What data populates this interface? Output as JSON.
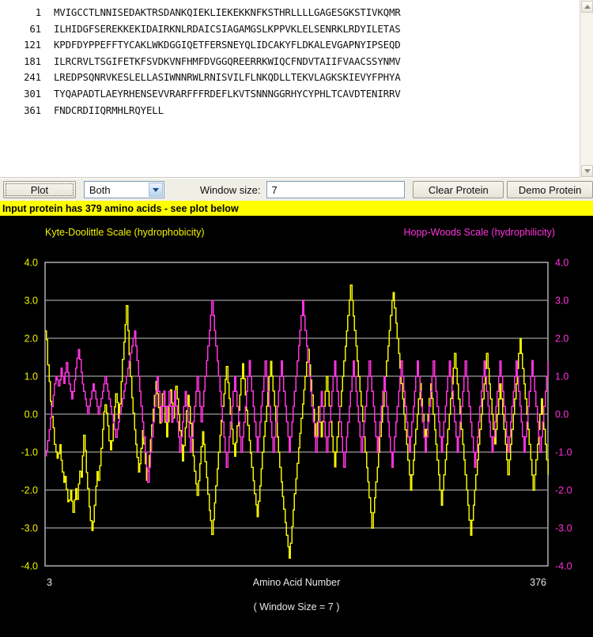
{
  "sequence": {
    "lines": [
      {
        "num": "1",
        "residues": "MVIGCCTLNNISEDAKTRSDANKQIEKLIEKEKKNFKSTHRLLLLGAGESGKSTIVKQMR"
      },
      {
        "num": "61",
        "residues": "ILHIDGFSEREKKEKIDAIRKNLRDAICSIAGAMGSLKPPVKLELSENRKLRDYILETAS"
      },
      {
        "num": "121",
        "residues": "KPDFDYPPEFFTYCAKLWKDGGIQETFERSNEYQLIDCAKYFLDKALEVGAPNYIPSEQD"
      },
      {
        "num": "181",
        "residues": "ILRCRVLTSGIFETKFSVDKVNFHMFDVGGQREERRKWIQCFNDVTAIIFVAACSSYNMV"
      },
      {
        "num": "241",
        "residues": "LREDPSQNRVKESLELLASIWNNRWLRNISVILFLNKQDLLTEKVLAGKSKIEVYFPHYA"
      },
      {
        "num": "301",
        "residues": "TYQAPADTLAEYRHENSEVVRARFFFRDEFLKVTSNNNGGRHYCYPHLTCAVDTENIRRV"
      },
      {
        "num": "361",
        "residues": "FNDCRDIIQRMHLRQYELL"
      }
    ]
  },
  "toolbar": {
    "plot_label": "Plot",
    "scale_selected": "Both",
    "scale_options": [
      "Both",
      "Kyte-Doolittle",
      "Hopp-Woods"
    ],
    "window_size_label": "Window size:",
    "window_size_value": "7",
    "clear_label": "Clear Protein",
    "demo_label": "Demo Protein"
  },
  "status": {
    "message": "Input protein has 379 amino acids - see plot below"
  },
  "chart_data": {
    "type": "line",
    "title_left": "Kyte-Doolittle Scale (hydrophobicity)",
    "title_right": "Hopp-Woods Scale (hydrophilicity)",
    "xlabel": "Amino Acid Number",
    "sublabel": "( Window Size = 7 )",
    "x_min_label": "3",
    "x_max_label": "376",
    "xlim": [
      3,
      376
    ],
    "ylim": [
      -4.0,
      4.0
    ],
    "grid": true,
    "legend_position": "top",
    "y_ticks": [
      "4.0",
      "3.0",
      "2.0",
      "1.0",
      "0.0",
      "-1.0",
      "-2.0",
      "-3.0",
      "-4.0"
    ],
    "y_tick_values": [
      4.0,
      3.0,
      2.0,
      1.0,
      0.0,
      -1.0,
      -2.0,
      -3.0,
      -4.0
    ],
    "axes": {
      "left": {
        "label": "Kyte-Doolittle Scale (hydrophobicity)",
        "color": "#f2f200",
        "ylim": [
          -4.0,
          4.0
        ]
      },
      "right": {
        "label": "Hopp-Woods Scale (hydrophilicity)",
        "color": "#ff33dd",
        "ylim": [
          -4.0,
          4.0
        ]
      }
    },
    "series": [
      {
        "name": "Kyte-Doolittle Scale (hydrophobicity)",
        "color": "#f2f200",
        "axis": "left",
        "values": [
          2.19,
          1.96,
          1.3,
          0.86,
          0.34,
          -0.06,
          -0.36,
          -0.8,
          -0.99,
          -1.16,
          -1.04,
          -0.81,
          -1.21,
          -1.53,
          -1.8,
          -1.64,
          -1.98,
          -2.31,
          -2.27,
          -2.01,
          -2.3,
          -2.59,
          -2.26,
          -1.96,
          -2.24,
          -1.84,
          -1.5,
          -1.66,
          -1.1,
          -0.56,
          -0.96,
          -1.54,
          -1.96,
          -2.44,
          -2.81,
          -3.07,
          -2.84,
          -2.4,
          -1.9,
          -1.52,
          -1.74,
          -1.36,
          -0.9,
          -0.4,
          0.06,
          0.24,
          0.03,
          -0.31,
          -0.7,
          -0.94,
          -0.7,
          -0.26,
          0.19,
          0.54,
          0.31,
          -0.11,
          0.27,
          0.86,
          1.44,
          1.9,
          2.36,
          2.86,
          2.2,
          1.57,
          1.0,
          0.43,
          0.03,
          -0.41,
          -0.8,
          -1.14,
          -1.53,
          -1.31,
          -0.9,
          -0.43,
          -0.79,
          -1.31,
          -1.74,
          -1.51,
          -1.09,
          -0.67,
          -0.29,
          0.13,
          0.5,
          0.86,
          0.54,
          0.17,
          -0.23,
          0.11,
          0.54,
          0.2,
          -0.21,
          -0.6,
          -0.2,
          0.24,
          0.64,
          0.3,
          -0.1,
          0.31,
          0.73,
          0.4,
          0.0,
          -0.43,
          -0.81,
          -1.23,
          -0.83,
          -0.36,
          0.09,
          0.5,
          0.2,
          -0.24,
          -0.66,
          -1.1,
          -1.51,
          -1.84,
          -2.14,
          -1.76,
          -1.31,
          -0.86,
          -0.46,
          -0.8,
          -1.26,
          -1.67,
          -2.11,
          -2.54,
          -2.81,
          -3.17,
          -2.79,
          -2.34,
          -1.89,
          -1.44,
          -1.0,
          -0.56,
          -0.16,
          0.2,
          0.54,
          0.91,
          1.26,
          0.83,
          0.41,
          0.0,
          -0.4,
          -0.79,
          -1.11,
          -0.74,
          -0.31,
          0.1,
          0.51,
          0.94,
          1.33,
          0.93,
          0.51,
          0.1,
          -0.3,
          -0.69,
          -1.03,
          -1.4,
          -1.76,
          -2.1,
          -2.39,
          -2.7,
          -2.3,
          -1.89,
          -1.44,
          -1.0,
          -0.59,
          -0.19,
          0.21,
          0.61,
          1.0,
          1.39,
          1.01,
          0.61,
          0.21,
          -0.2,
          -0.6,
          -1.0,
          -1.4,
          -1.79,
          -2.17,
          -2.51,
          -2.86,
          -3.19,
          -3.49,
          -3.8,
          -3.4,
          -2.96,
          -2.53,
          -2.1,
          -1.7,
          -1.3,
          -0.89,
          -0.5,
          -0.11,
          0.27,
          0.64,
          1.0,
          1.37,
          1.7,
          1.3,
          0.9,
          0.51,
          0.13,
          -0.26,
          -0.6,
          -0.21,
          0.19,
          -0.21,
          -0.6,
          -0.19,
          0.2,
          0.6,
          0.99,
          0.6,
          0.21,
          -0.19,
          -0.59,
          -0.99,
          -1.39,
          -1.0,
          -0.6,
          -0.2,
          0.2,
          0.61,
          1.0,
          1.4,
          1.79,
          2.19,
          2.6,
          3.01,
          3.4,
          3.0,
          2.59,
          2.2,
          1.8,
          1.4,
          1.0,
          0.6,
          0.21,
          -0.19,
          -0.6,
          -1.0,
          -1.41,
          -1.79,
          -2.2,
          -2.59,
          -3.0,
          -2.6,
          -2.2,
          -1.79,
          -1.4,
          -1.0,
          -0.59,
          -0.21,
          0.2,
          0.6,
          1.0,
          1.4,
          1.8,
          2.2,
          2.6,
          3.0,
          3.2,
          2.8,
          2.4,
          2.0,
          1.6,
          1.21,
          0.81,
          0.4,
          0.0,
          -0.41,
          -0.8,
          -1.21,
          -1.6,
          -2.0,
          -1.6,
          -1.21,
          -0.8,
          -0.4,
          0.0,
          0.4,
          0.81,
          0.4,
          0.0,
          -0.4,
          -0.8,
          -0.4,
          0.0,
          0.41,
          0.8,
          0.41,
          0.0,
          -0.41,
          -0.8,
          -1.21,
          -1.6,
          -2.01,
          -2.4,
          -2.0,
          -1.6,
          -1.2,
          -0.8,
          -0.4,
          0.0,
          0.41,
          0.8,
          1.21,
          1.6,
          1.2,
          0.8,
          0.4,
          0.01,
          -0.4,
          -0.8,
          -1.2,
          -1.6,
          -2.0,
          -2.4,
          -2.8,
          -3.19,
          -2.8,
          -2.4,
          -2.0,
          -1.6,
          -1.2,
          -0.8,
          -0.4,
          0.0,
          0.4,
          0.8,
          1.2,
          1.6,
          1.2,
          0.8,
          0.4,
          0.0,
          -0.4,
          -0.79,
          -0.4,
          0.0,
          0.4,
          0.8,
          0.4,
          0.0,
          -0.4,
          -0.8,
          -1.2,
          -1.6,
          -1.2,
          -0.8,
          -0.4,
          0.0,
          0.4,
          0.8,
          1.2,
          1.6,
          2.0,
          1.6,
          1.2,
          0.8,
          0.4,
          0.0,
          -0.4,
          -0.8,
          -1.2,
          -1.61,
          -2.01,
          -1.6,
          -1.2,
          -0.8,
          -0.4,
          0.0,
          0.4,
          0.0,
          -0.4,
          -0.8,
          -1.2,
          -1.6
        ]
      },
      {
        "name": "Hopp-Woods Scale (hydrophilicity)",
        "color": "#ff33dd",
        "axis": "right",
        "values": [
          -1.1,
          -0.96,
          -0.7,
          -0.41,
          -0.1,
          0.2,
          0.5,
          0.8,
          1.0,
          0.9,
          0.74,
          0.9,
          1.21,
          1.0,
          0.81,
          1.09,
          1.36,
          1.1,
          0.8,
          0.6,
          0.4,
          0.6,
          0.9,
          1.21,
          1.47,
          1.7,
          1.44,
          1.1,
          0.8,
          0.6,
          0.4,
          0.21,
          0.01,
          0.21,
          0.4,
          0.61,
          0.8,
          0.61,
          0.4,
          0.2,
          0.0,
          0.2,
          0.41,
          0.6,
          0.8,
          1.0,
          0.8,
          0.61,
          0.4,
          0.2,
          0.0,
          -0.2,
          -0.4,
          -0.61,
          -0.4,
          -0.2,
          0.0,
          0.2,
          0.41,
          0.61,
          0.8,
          1.0,
          1.21,
          1.4,
          1.61,
          1.8,
          2.0,
          2.19,
          1.8,
          1.41,
          1.0,
          0.6,
          0.21,
          -0.2,
          -0.6,
          -1.0,
          -1.4,
          -1.8,
          -1.4,
          -1.0,
          -0.6,
          -0.2,
          0.2,
          0.61,
          1.0,
          0.6,
          0.2,
          -0.2,
          0.2,
          0.61,
          0.2,
          -0.2,
          0.21,
          0.6,
          0.2,
          -0.21,
          0.2,
          0.61,
          0.21,
          -0.2,
          -0.6,
          -1.0,
          -0.6,
          -0.2,
          0.2,
          0.6,
          0.21,
          -0.2,
          -0.6,
          -1.0,
          -0.6,
          -0.2,
          0.2,
          0.6,
          1.0,
          0.6,
          0.2,
          -0.2,
          0.2,
          0.61,
          1.0,
          1.41,
          1.8,
          2.2,
          2.61,
          3.0,
          2.6,
          2.2,
          1.8,
          1.4,
          1.01,
          0.6,
          0.21,
          -0.2,
          -0.61,
          -1.0,
          -1.4,
          -1.01,
          -0.6,
          -0.2,
          0.2,
          0.6,
          1.0,
          0.6,
          0.2,
          -0.2,
          -0.6,
          -1.0,
          -0.6,
          -0.21,
          0.2,
          0.6,
          1.0,
          1.41,
          1.0,
          0.61,
          0.2,
          -0.2,
          -0.6,
          -1.0,
          -0.6,
          -0.2,
          0.21,
          0.6,
          1.0,
          1.4,
          1.0,
          0.6,
          0.2,
          -0.2,
          -0.61,
          -1.0,
          -0.6,
          -0.2,
          0.2,
          0.61,
          1.0,
          1.4,
          1.0,
          0.6,
          0.21,
          -0.2,
          -0.6,
          -1.0,
          -0.6,
          -0.2,
          0.2,
          0.6,
          1.0,
          1.4,
          1.81,
          2.2,
          2.6,
          3.01,
          2.6,
          2.2,
          1.8,
          1.4,
          1.0,
          0.6,
          0.2,
          -0.2,
          -0.6,
          -1.0,
          -0.6,
          -0.2,
          0.2,
          0.6,
          0.2,
          -0.2,
          -0.6,
          -1.0,
          -0.6,
          -0.21,
          0.2,
          0.6,
          1.0,
          1.4,
          1.0,
          0.6,
          0.2,
          -0.2,
          -0.6,
          -1.0,
          -1.4,
          -1.0,
          -0.6,
          -0.21,
          0.2,
          0.6,
          1.0,
          1.4,
          1.0,
          0.6,
          0.21,
          -0.2,
          -0.6,
          -1.0,
          -0.6,
          -0.2,
          0.2,
          0.61,
          1.0,
          1.4,
          1.0,
          0.6,
          0.2,
          -0.2,
          -0.6,
          -1.0,
          -0.6,
          -0.2,
          0.21,
          0.6,
          1.0,
          0.6,
          0.2,
          -0.2,
          -0.6,
          -1.0,
          -1.4,
          -1.0,
          -0.6,
          -0.2,
          0.2,
          0.61,
          1.0,
          1.4,
          1.0,
          0.6,
          0.2,
          -0.21,
          -0.6,
          -1.0,
          -0.6,
          -0.2,
          0.2,
          0.6,
          1.0,
          1.4,
          1.0,
          0.6,
          0.2,
          -0.2,
          -0.61,
          -1.0,
          -0.6,
          -0.2,
          0.2,
          0.6,
          1.0,
          1.4,
          1.0,
          0.6,
          0.2,
          -0.2,
          -0.6,
          -1.0,
          -0.6,
          -0.2,
          0.21,
          0.6,
          1.0,
          1.4,
          1.0,
          0.61,
          0.2,
          -0.2,
          -0.6,
          -1.0,
          -0.6,
          -0.2,
          0.2,
          0.6,
          1.0,
          1.4,
          1.0,
          0.6,
          0.2,
          -0.21,
          -0.6,
          -1.0,
          -1.4,
          -1.0,
          -0.6,
          -0.2,
          0.2,
          0.61,
          1.0,
          1.4,
          1.0,
          0.6,
          0.21,
          -0.2,
          -0.6,
          -1.0,
          -0.6,
          -0.2,
          0.2,
          0.6,
          1.0,
          1.4,
          1.0,
          0.6,
          0.2,
          -0.2,
          -0.6,
          -1.0,
          -0.6,
          -0.2,
          0.2,
          0.6,
          1.0,
          1.4,
          1.0,
          0.6,
          0.21,
          -0.2,
          -0.6,
          -1.0,
          -0.6,
          -0.2,
          0.2,
          0.6,
          1.0,
          1.41,
          1.0,
          0.6,
          0.2,
          -0.2,
          -0.6,
          -1.0,
          -0.6,
          -0.2,
          0.2,
          0.6,
          1.0,
          1.4
        ]
      }
    ]
  }
}
